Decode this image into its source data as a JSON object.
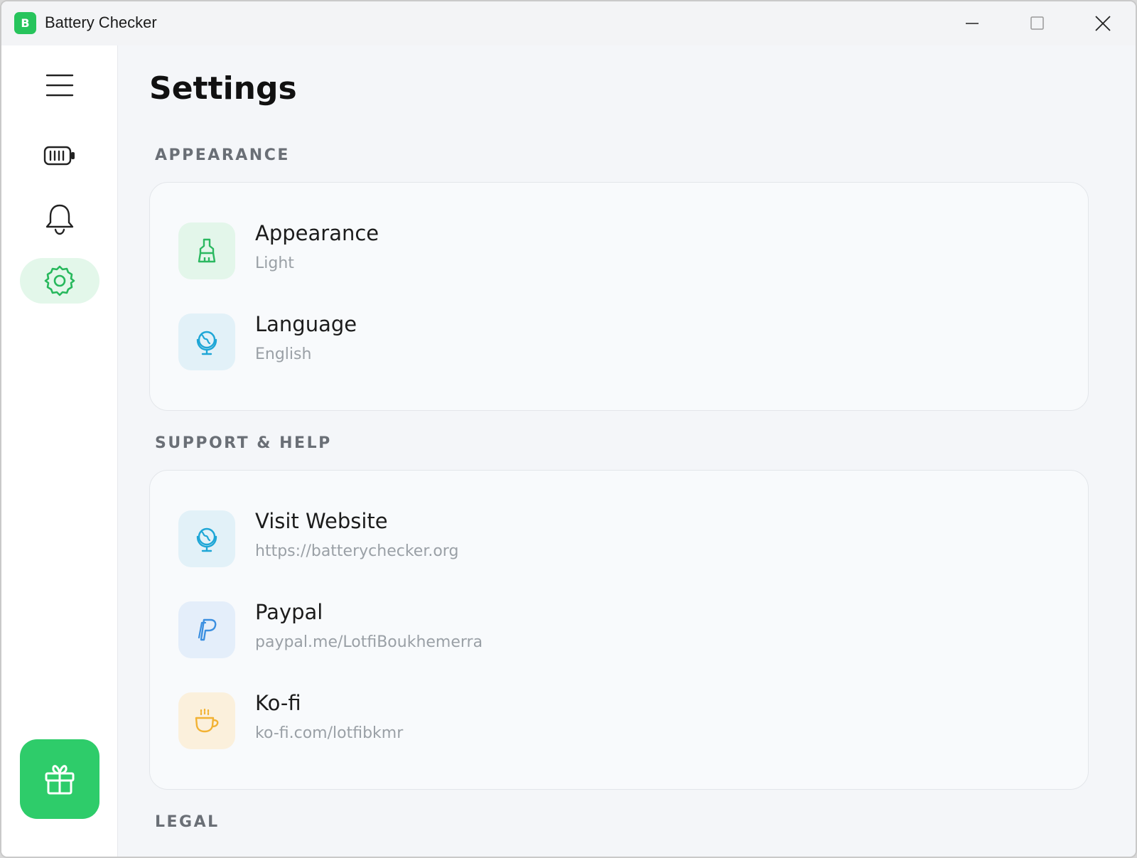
{
  "window": {
    "title": "Battery Checker",
    "app_icon_glyph": "B",
    "controls": [
      "minimize-icon",
      "maximize-icon",
      "close-icon"
    ]
  },
  "sidebar": {
    "items": [
      {
        "name": "menu",
        "icon": "hamburger-menu-icon",
        "active": false
      },
      {
        "name": "battery",
        "icon": "battery-icon",
        "active": false
      },
      {
        "name": "notifications",
        "icon": "bell-icon",
        "active": false
      },
      {
        "name": "settings",
        "icon": "gear-icon",
        "active": true
      }
    ],
    "gift_button_icon": "gift-icon"
  },
  "main": {
    "title": "Settings",
    "sections": [
      {
        "header": "APPEARANCE",
        "rows": [
          {
            "title": "Appearance",
            "subtitle": "Light",
            "icon": "paintbrush-icon",
            "icon_color": "#2bb860",
            "icon_bg": "#e3f6ea"
          },
          {
            "title": "Language",
            "subtitle": "English",
            "icon": "globe-icon",
            "icon_color": "#1ea6d6",
            "icon_bg": "#e2f1f8"
          }
        ]
      },
      {
        "header": "SUPPORT & HELP",
        "rows": [
          {
            "title": "Visit Website",
            "subtitle": "https://batterychecker.org",
            "icon": "globe-icon",
            "icon_color": "#1ea6d6",
            "icon_bg": "#e2f1f8"
          },
          {
            "title": "Paypal",
            "subtitle": "paypal.me/LotfiBoukhemerra",
            "icon": "paypal-icon",
            "icon_color": "#3b8fe0",
            "icon_bg": "#e4eefa"
          },
          {
            "title": "Ko-fi",
            "subtitle": "ko-fi.com/lotfibkmr",
            "icon": "coffee-cup-icon",
            "icon_color": "#f2b233",
            "icon_bg": "#fbf0dc"
          }
        ]
      },
      {
        "header": "LEGAL",
        "rows": []
      }
    ]
  },
  "colors": {
    "accent": "#2ecc6a",
    "accent_light": "#e3f7ea",
    "background": "#f4f6f9"
  }
}
